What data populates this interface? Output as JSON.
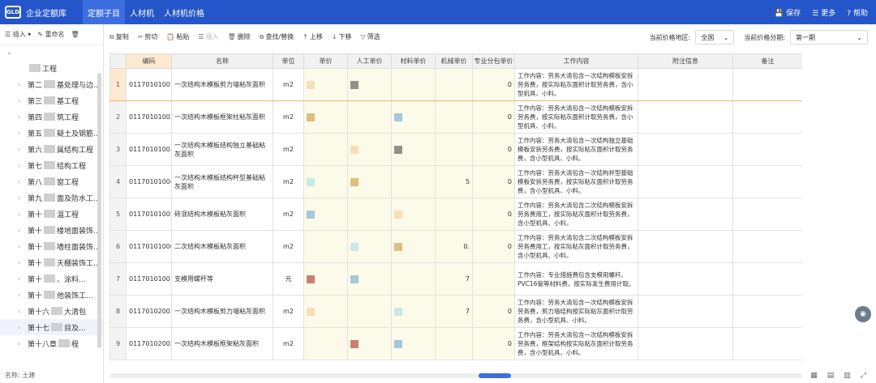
{
  "app": {
    "logo_text": "GLD",
    "title": "企业定额库",
    "tabs": [
      "定额子目",
      "人材机",
      "人材机价格"
    ],
    "actions": {
      "save": "保存",
      "more": "更多",
      "help": "帮助"
    }
  },
  "sidebar": {
    "tools": {
      "insert": "插入",
      "rename": "重命名"
    },
    "items": [
      {
        "pre": "",
        "post": "工程"
      },
      {
        "pre": "第二",
        "post": "基处理与边..."
      },
      {
        "pre": "第三",
        "post": "基工程"
      },
      {
        "pre": "第四",
        "post": "筑工程"
      },
      {
        "pre": "第五",
        "post": "疑土及钢筋..."
      },
      {
        "pre": "第六",
        "post": "属结构工程"
      },
      {
        "pre": "第七",
        "post": "结构工程"
      },
      {
        "pre": "第八",
        "post": "窗工程"
      },
      {
        "pre": "第九",
        "post": "面及防水工..."
      },
      {
        "pre": "第十",
        "post": "温工程"
      },
      {
        "pre": "第十",
        "post": "楼地面装饰..."
      },
      {
        "pre": "第十",
        "post": "墙柱面装饰..."
      },
      {
        "pre": "第十",
        "post": "天棚装饰工..."
      },
      {
        "pre": "第十",
        "post": "、涂料..."
      },
      {
        "pre": "第十",
        "post": "他装饰工..."
      },
      {
        "pre": "第十六",
        "post": "大清包"
      },
      {
        "pre": "第十七",
        "post": "目及..."
      },
      {
        "pre": "第十八章",
        "post": "程"
      }
    ],
    "footer": "名称: 土建"
  },
  "toolbar": {
    "items": [
      "复制",
      "剪切",
      "粘贴",
      "插入",
      "删除",
      "查找/替换",
      "上移",
      "下移",
      "筛选"
    ],
    "region_label": "当前价格地区:",
    "region_value": "全国",
    "period_label": "当前价格分期:",
    "period_value": "第一期"
  },
  "table": {
    "headers": [
      "编码",
      "名称",
      "单位",
      "单价",
      "人工单价",
      "材料单价",
      "机械单价",
      "专业分包单价",
      "工作内容",
      "附注信息",
      "备注"
    ],
    "rows": [
      {
        "no": "1",
        "code": "01170101001",
        "name": "一次结构木模板剪力墙粘灰面积",
        "unit": "m2",
        "price_labor": "",
        "price_sub": "0",
        "content": "工作内容：劳务大清包含一次结构模板安拆劳务费，按实际粘灰面积计取劳务费，含小型机具、小料。"
      },
      {
        "no": "2",
        "code": "01170101002",
        "name": "一次结构木模板框架柱粘灰面积",
        "unit": "m2",
        "price_labor": "",
        "price_sub": "0",
        "content": "工作内容：劳务大清包含一次结构模板安拆劳务费，按实际粘灰面积计取劳务费，含小型机具、小料。"
      },
      {
        "no": "3",
        "code": "01170101003",
        "name": "一次结构木模板结构独立基础粘灰面积",
        "unit": "m2",
        "price_labor": "",
        "price_sub": "0",
        "content": "工作内容：劳务大清包含一次结构独立基础模板安拆劳务费，按实际粘灰面积计取劳务费，含小型机具、小料。"
      },
      {
        "no": "4",
        "code": "01170101004",
        "name": "一次结构木模板结构杯型基础粘灰面积",
        "unit": "m2",
        "price_labor": "5",
        "price_sub": "0",
        "content": "工作内容：劳务大清包含一次结构杯型基础模板安拆劳务费，按实际粘灰面积计取劳务费，含小型机具、小料。"
      },
      {
        "no": "5",
        "code": "01170101005",
        "name": "砖混结构木模板粘灰面积",
        "unit": "m2",
        "price_labor": "",
        "price_sub": "0",
        "content": "工作内容：劳务大清包含二次结构模板安拆劳务费用工，按实际粘灰面积计取劳务费，含小型机具、小料。"
      },
      {
        "no": "6",
        "code": "01170101006",
        "name": "二次结构木模板粘灰面积",
        "unit": "m2",
        "price_labor": "0.",
        "price_sub": "0",
        "content": "工作内容：劳务大清包含二次结构模板安拆劳务费用工，按实际粘灰面积计取劳务费，含小型机具、小料。"
      },
      {
        "no": "7",
        "code": "01170101007",
        "name": "支模用螺杆等",
        "unit": "元",
        "price_labor": "7",
        "price_sub": "",
        "content": "工作内容：专业措施费包含支模用螺杆、PVC16管等材料费，按实际发生费用计取。"
      },
      {
        "no": "8",
        "code": "01170102001",
        "name": "一次结构木模板剪力墙粘灰面积",
        "unit": "m2",
        "price_labor": "7",
        "price_sub": "0",
        "content": "工作内容：劳务大清包含一次结构模板安拆劳务费，剪力墙结构按实际粘灰面积计取劳务费，含小型机具、小料。"
      },
      {
        "no": "9",
        "code": "01170102002",
        "name": "一次结构木模板框架粘灰面积",
        "unit": "m2",
        "price_labor": "",
        "price_sub": "0",
        "content": "工作内容：劳务大清包含一次结构模板安拆劳务费，框架结构按实际粘灰面积计取劳务费，含小型机具、小料。"
      }
    ]
  },
  "status": {
    "icons": [
      "grid-view-icon",
      "panel-view-icon",
      "table-view-icon",
      "fullscreen-icon"
    ]
  }
}
